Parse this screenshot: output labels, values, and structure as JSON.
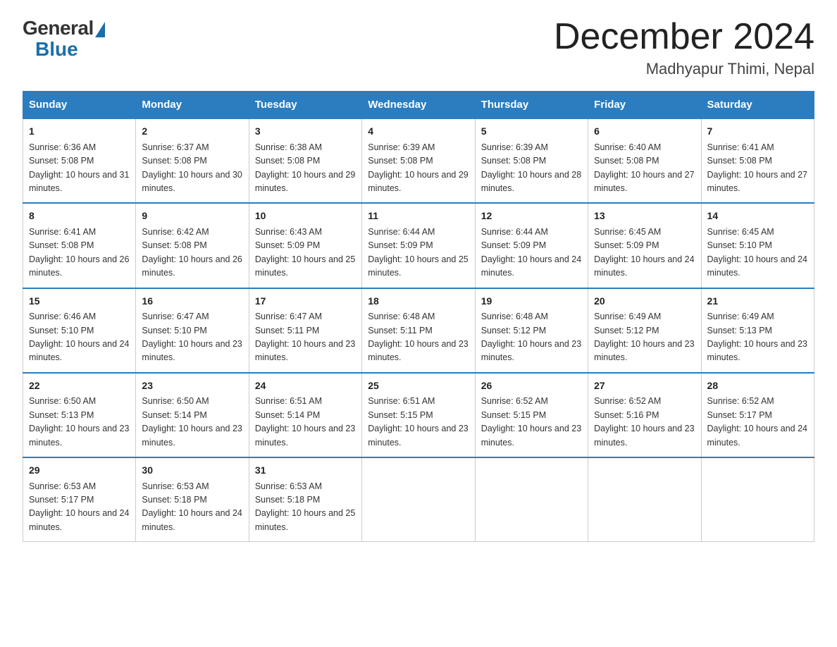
{
  "logo": {
    "general": "General",
    "blue": "Blue"
  },
  "header": {
    "month": "December 2024",
    "location": "Madhyapur Thimi, Nepal"
  },
  "weekdays": [
    "Sunday",
    "Monday",
    "Tuesday",
    "Wednesday",
    "Thursday",
    "Friday",
    "Saturday"
  ],
  "weeks": [
    [
      {
        "day": "1",
        "sunrise": "6:36 AM",
        "sunset": "5:08 PM",
        "daylight": "10 hours and 31 minutes."
      },
      {
        "day": "2",
        "sunrise": "6:37 AM",
        "sunset": "5:08 PM",
        "daylight": "10 hours and 30 minutes."
      },
      {
        "day": "3",
        "sunrise": "6:38 AM",
        "sunset": "5:08 PM",
        "daylight": "10 hours and 29 minutes."
      },
      {
        "day": "4",
        "sunrise": "6:39 AM",
        "sunset": "5:08 PM",
        "daylight": "10 hours and 29 minutes."
      },
      {
        "day": "5",
        "sunrise": "6:39 AM",
        "sunset": "5:08 PM",
        "daylight": "10 hours and 28 minutes."
      },
      {
        "day": "6",
        "sunrise": "6:40 AM",
        "sunset": "5:08 PM",
        "daylight": "10 hours and 27 minutes."
      },
      {
        "day": "7",
        "sunrise": "6:41 AM",
        "sunset": "5:08 PM",
        "daylight": "10 hours and 27 minutes."
      }
    ],
    [
      {
        "day": "8",
        "sunrise": "6:41 AM",
        "sunset": "5:08 PM",
        "daylight": "10 hours and 26 minutes."
      },
      {
        "day": "9",
        "sunrise": "6:42 AM",
        "sunset": "5:08 PM",
        "daylight": "10 hours and 26 minutes."
      },
      {
        "day": "10",
        "sunrise": "6:43 AM",
        "sunset": "5:09 PM",
        "daylight": "10 hours and 25 minutes."
      },
      {
        "day": "11",
        "sunrise": "6:44 AM",
        "sunset": "5:09 PM",
        "daylight": "10 hours and 25 minutes."
      },
      {
        "day": "12",
        "sunrise": "6:44 AM",
        "sunset": "5:09 PM",
        "daylight": "10 hours and 24 minutes."
      },
      {
        "day": "13",
        "sunrise": "6:45 AM",
        "sunset": "5:09 PM",
        "daylight": "10 hours and 24 minutes."
      },
      {
        "day": "14",
        "sunrise": "6:45 AM",
        "sunset": "5:10 PM",
        "daylight": "10 hours and 24 minutes."
      }
    ],
    [
      {
        "day": "15",
        "sunrise": "6:46 AM",
        "sunset": "5:10 PM",
        "daylight": "10 hours and 24 minutes."
      },
      {
        "day": "16",
        "sunrise": "6:47 AM",
        "sunset": "5:10 PM",
        "daylight": "10 hours and 23 minutes."
      },
      {
        "day": "17",
        "sunrise": "6:47 AM",
        "sunset": "5:11 PM",
        "daylight": "10 hours and 23 minutes."
      },
      {
        "day": "18",
        "sunrise": "6:48 AM",
        "sunset": "5:11 PM",
        "daylight": "10 hours and 23 minutes."
      },
      {
        "day": "19",
        "sunrise": "6:48 AM",
        "sunset": "5:12 PM",
        "daylight": "10 hours and 23 minutes."
      },
      {
        "day": "20",
        "sunrise": "6:49 AM",
        "sunset": "5:12 PM",
        "daylight": "10 hours and 23 minutes."
      },
      {
        "day": "21",
        "sunrise": "6:49 AM",
        "sunset": "5:13 PM",
        "daylight": "10 hours and 23 minutes."
      }
    ],
    [
      {
        "day": "22",
        "sunrise": "6:50 AM",
        "sunset": "5:13 PM",
        "daylight": "10 hours and 23 minutes."
      },
      {
        "day": "23",
        "sunrise": "6:50 AM",
        "sunset": "5:14 PM",
        "daylight": "10 hours and 23 minutes."
      },
      {
        "day": "24",
        "sunrise": "6:51 AM",
        "sunset": "5:14 PM",
        "daylight": "10 hours and 23 minutes."
      },
      {
        "day": "25",
        "sunrise": "6:51 AM",
        "sunset": "5:15 PM",
        "daylight": "10 hours and 23 minutes."
      },
      {
        "day": "26",
        "sunrise": "6:52 AM",
        "sunset": "5:15 PM",
        "daylight": "10 hours and 23 minutes."
      },
      {
        "day": "27",
        "sunrise": "6:52 AM",
        "sunset": "5:16 PM",
        "daylight": "10 hours and 23 minutes."
      },
      {
        "day": "28",
        "sunrise": "6:52 AM",
        "sunset": "5:17 PM",
        "daylight": "10 hours and 24 minutes."
      }
    ],
    [
      {
        "day": "29",
        "sunrise": "6:53 AM",
        "sunset": "5:17 PM",
        "daylight": "10 hours and 24 minutes."
      },
      {
        "day": "30",
        "sunrise": "6:53 AM",
        "sunset": "5:18 PM",
        "daylight": "10 hours and 24 minutes."
      },
      {
        "day": "31",
        "sunrise": "6:53 AM",
        "sunset": "5:18 PM",
        "daylight": "10 hours and 25 minutes."
      },
      null,
      null,
      null,
      null
    ]
  ]
}
